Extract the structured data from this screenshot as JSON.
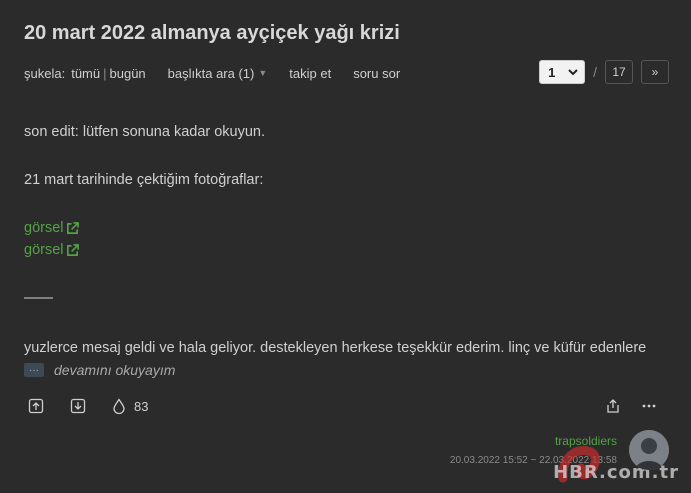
{
  "title": "20 mart 2022 almanya ayçiçek yağı krizi",
  "subnav": {
    "sukela_label": "şukela:",
    "tumu": "tümü",
    "separator": "|",
    "bugun": "bugün",
    "baslikta_ara": "başlıkta ara (1)",
    "takip_et": "takip et",
    "soru_sor": "soru sor"
  },
  "pager": {
    "current": "1",
    "slash": "/",
    "total": "17",
    "next": "»"
  },
  "entry": {
    "line1": "son edit: lütfen sonuna kadar okuyun.",
    "line2": "21 mart tarihinde çektiğim fotoğraflar:",
    "link1": "görsel",
    "link2": "görsel",
    "divider": "——",
    "line4": "yuzlerce mesaj geldi ve hala geliyor. destekleyen herkese teşekkür ederim. linç ve küfür edenlere",
    "more_dots": "···",
    "more_label": "devamını okuyayım"
  },
  "actions": {
    "fav_count": "83"
  },
  "meta": {
    "author": "trapsoldiers",
    "date": "20.03.2022 15:52 ~ 22.03.2022 13:58"
  },
  "watermark": {
    "text": "HBR.com.tr"
  },
  "colors": {
    "background": "#2b2b2b",
    "link": "#53a245",
    "text": "#d0d0d0"
  }
}
